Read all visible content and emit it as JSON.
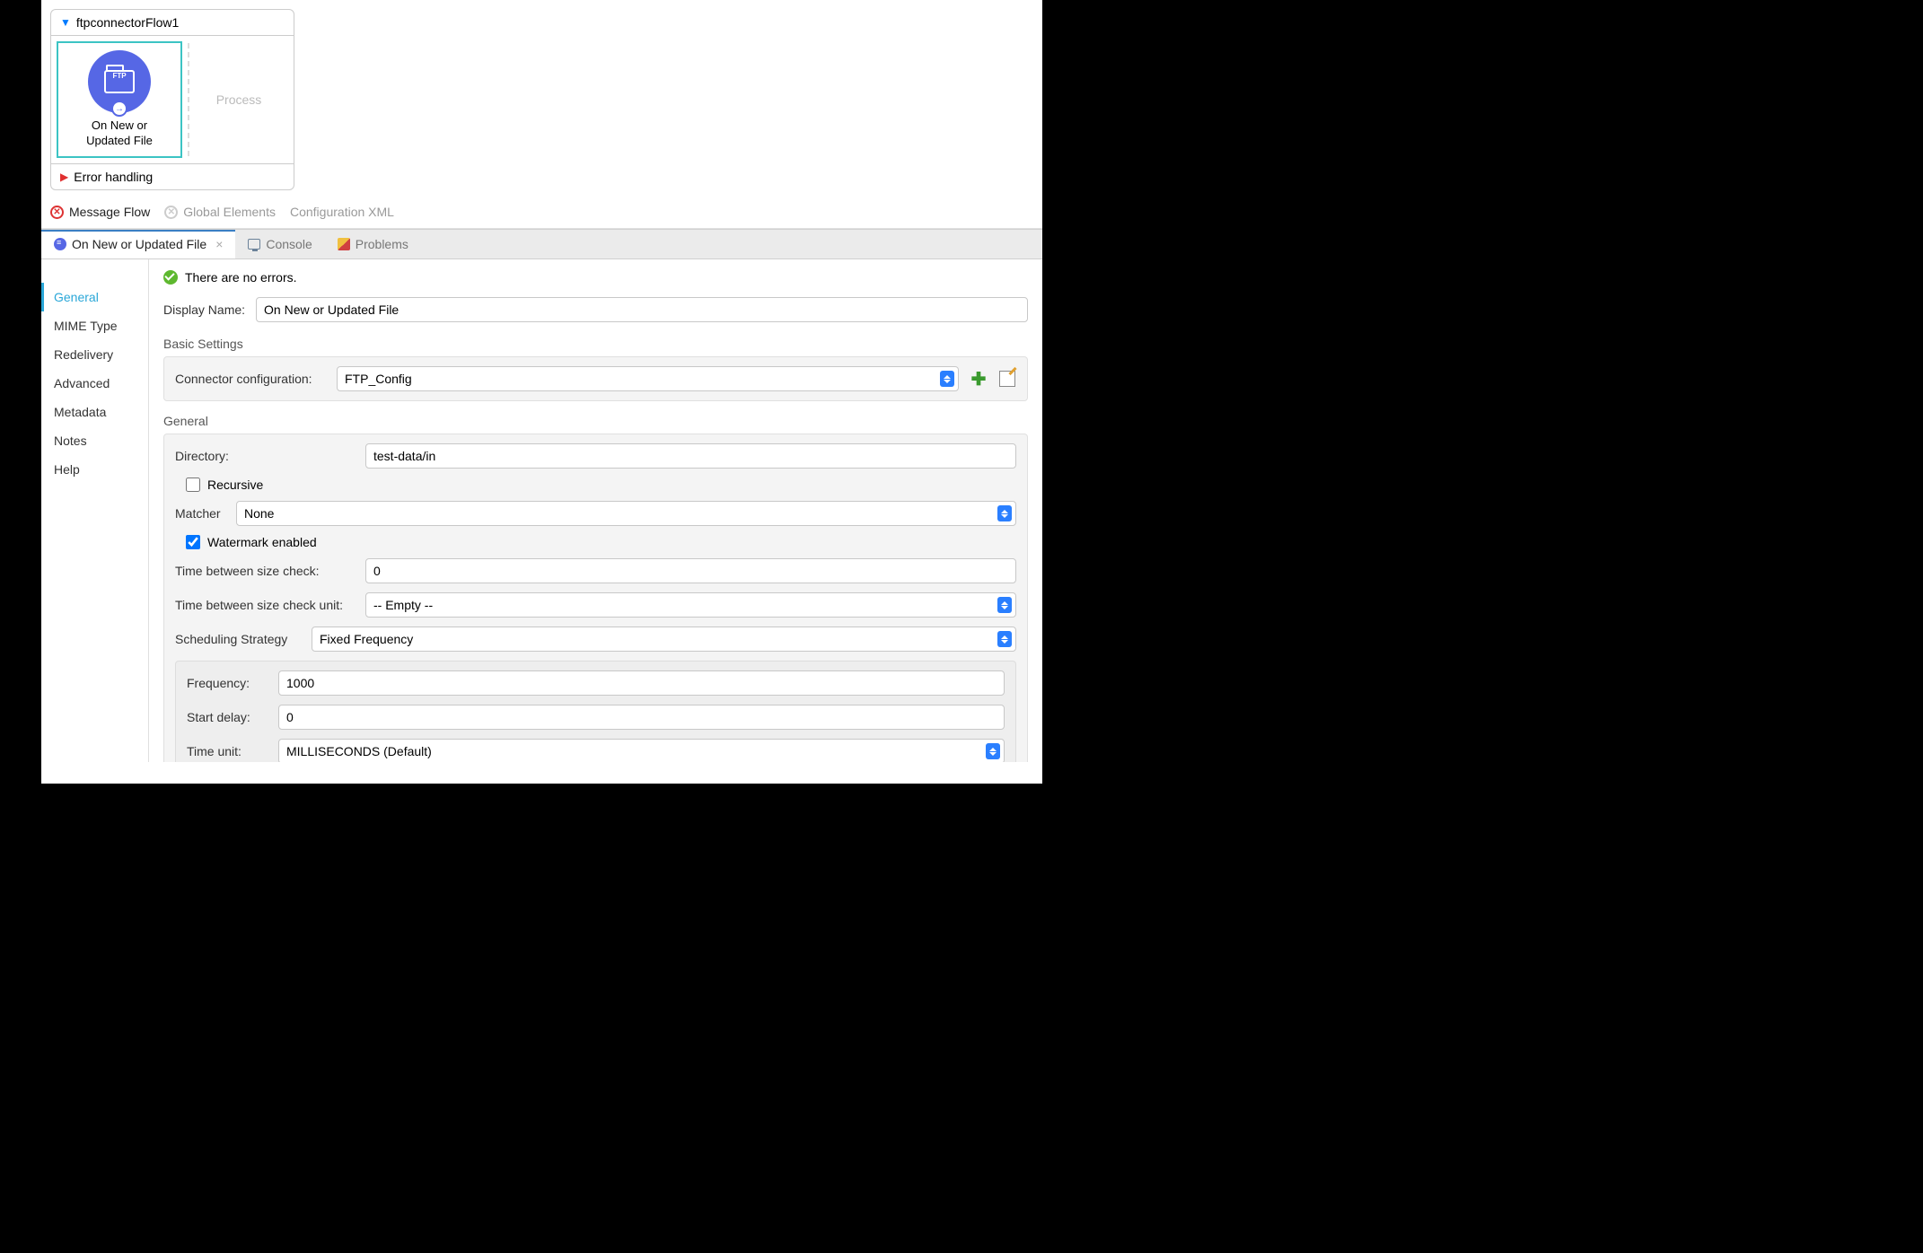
{
  "flow": {
    "name": "ftpconnectorFlow1",
    "node_label": "On New or\nUpdated File",
    "ftp_badge": "FTP",
    "process_placeholder": "Process",
    "error_handling": "Error handling"
  },
  "bottom_tabs": {
    "message_flow": "Message Flow",
    "global_elements": "Global Elements",
    "config_xml": "Configuration XML"
  },
  "editor_tabs": {
    "active": "On New or Updated File",
    "console": "Console",
    "problems": "Problems"
  },
  "status": "There are no errors.",
  "sidebar": {
    "items": [
      "General",
      "MIME Type",
      "Redelivery",
      "Advanced",
      "Metadata",
      "Notes",
      "Help"
    ]
  },
  "form": {
    "display_name_label": "Display Name:",
    "display_name_value": "On New or Updated File",
    "basic_settings_title": "Basic Settings",
    "connector_config_label": "Connector configuration:",
    "connector_config_value": "FTP_Config",
    "general_title": "General",
    "directory_label": "Directory:",
    "directory_value": "test-data/in",
    "recursive_label": "Recursive",
    "recursive_checked": false,
    "matcher_label": "Matcher",
    "matcher_value": "None",
    "watermark_label": "Watermark enabled",
    "watermark_checked": true,
    "time_size_check_label": "Time between size check:",
    "time_size_check_value": "0",
    "time_size_unit_label": "Time between size check unit:",
    "time_size_unit_value": "-- Empty --",
    "scheduling_label": "Scheduling Strategy",
    "scheduling_value": "Fixed Frequency",
    "frequency_label": "Frequency:",
    "frequency_value": "1000",
    "start_delay_label": "Start delay:",
    "start_delay_value": "0",
    "time_unit_label": "Time unit:",
    "time_unit_value": "MILLISECONDS (Default)"
  }
}
